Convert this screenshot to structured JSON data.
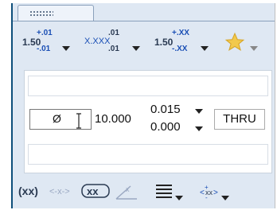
{
  "toolbar_top": {
    "tol1": {
      "base": "1.50",
      "upper": "+.01",
      "lower": "-.01"
    },
    "tol2": {
      "base": "X.XXX",
      "upper": ".01",
      "lower": ".01"
    },
    "tol3": {
      "base": "1.50",
      "upper": "+.XX",
      "lower": "-.XX"
    }
  },
  "dimension": {
    "symbol": "Ø",
    "value": "10.000",
    "upper_tol": "0.015",
    "lower_tol": "0.000",
    "depth": "THRU"
  },
  "icons": {
    "favorite": "star-icon",
    "cursor": "text-cursor-icon",
    "justify": "align-justify-icon"
  },
  "colors": {
    "frame_border": "#0e4f7b",
    "panel_bg": "#dfe8f3",
    "tolerance_blue": "#1a4fb5",
    "star_gold": "#f2c94c"
  }
}
